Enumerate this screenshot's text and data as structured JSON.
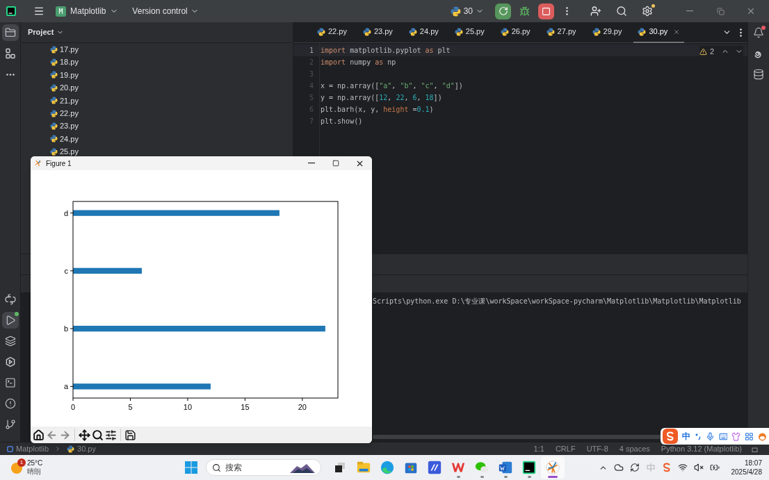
{
  "title_bar": {
    "project_badge": "M",
    "project": "Matplotlib",
    "vcs": "Version control",
    "run_config": "30"
  },
  "tool_stripe": {
    "left_top": [
      {
        "kind": "folder",
        "selected": true
      },
      {
        "kind": "structure",
        "selected": false
      },
      {
        "kind": "more",
        "selected": false
      }
    ],
    "left_bottom": [
      {
        "kind": "python",
        "selected": false
      },
      {
        "kind": "run",
        "selected": true
      },
      {
        "kind": "layers",
        "selected": false
      },
      {
        "kind": "services",
        "selected": false
      },
      {
        "kind": "terminal",
        "selected": false
      },
      {
        "kind": "problems",
        "selected": false
      },
      {
        "kind": "git",
        "selected": false
      }
    ],
    "right": [
      {
        "kind": "bell",
        "selected": false
      },
      {
        "kind": "spiral",
        "selected": false
      },
      {
        "kind": "database",
        "selected": false
      }
    ]
  },
  "project_panel": {
    "title": "Project",
    "files": [
      "17.py",
      "18.py",
      "19.py",
      "20.py",
      "21.py",
      "22.py",
      "23.py",
      "24.py",
      "25.py"
    ]
  },
  "editor": {
    "tabs": [
      {
        "label": "22.py",
        "selected": false
      },
      {
        "label": "23.py",
        "selected": false
      },
      {
        "label": "24.py",
        "selected": false
      },
      {
        "label": "25.py",
        "selected": false
      },
      {
        "label": "26.py",
        "selected": false
      },
      {
        "label": "27.py",
        "selected": false
      },
      {
        "label": "29.py",
        "selected": false
      },
      {
        "label": "30.py",
        "selected": true
      }
    ],
    "warnings": "2",
    "lines": [
      {
        "number": "1",
        "current": true,
        "tokens": [
          {
            "kind": "keyword",
            "text": "import"
          },
          {
            "kind": "plain",
            "text": " matplotlib.pyplot "
          },
          {
            "kind": "keyword",
            "text": "as"
          },
          {
            "kind": "plain",
            "text": " plt"
          }
        ]
      },
      {
        "number": "2",
        "current": false,
        "tokens": [
          {
            "kind": "keyword",
            "text": "import"
          },
          {
            "kind": "plain",
            "text": " numpy "
          },
          {
            "kind": "keyword",
            "text": "as"
          },
          {
            "kind": "plain",
            "text": " np"
          }
        ]
      },
      {
        "number": "3",
        "current": false
      },
      {
        "number": "4",
        "current": false,
        "tokens": [
          {
            "kind": "plain",
            "text": "x = np.array(["
          },
          {
            "kind": "string",
            "text": "\"a\""
          },
          {
            "kind": "plain",
            "text": ", "
          },
          {
            "kind": "string",
            "text": "\"b\""
          },
          {
            "kind": "plain",
            "text": ", "
          },
          {
            "kind": "string",
            "text": "\"c\""
          },
          {
            "kind": "plain",
            "text": ", "
          },
          {
            "kind": "string",
            "text": "\"d\""
          },
          {
            "kind": "plain",
            "text": "])"
          }
        ]
      },
      {
        "number": "5",
        "current": false,
        "tokens": [
          {
            "kind": "plain",
            "text": "y = np.array(["
          },
          {
            "kind": "number",
            "text": "12"
          },
          {
            "kind": "plain",
            "text": ", "
          },
          {
            "kind": "number",
            "text": "22"
          },
          {
            "kind": "plain",
            "text": ", "
          },
          {
            "kind": "number",
            "text": "6"
          },
          {
            "kind": "plain",
            "text": ", "
          },
          {
            "kind": "number",
            "text": "18"
          },
          {
            "kind": "plain",
            "text": "])"
          }
        ]
      },
      {
        "number": "6",
        "current": false,
        "tokens": [
          {
            "kind": "plain",
            "text": "plt.barh(x, y, "
          },
          {
            "kind": "param",
            "text": "height"
          },
          {
            "kind": "plain",
            "text": " ="
          },
          {
            "kind": "number",
            "text": "0.1"
          },
          {
            "kind": "plain",
            "text": ")"
          }
        ]
      },
      {
        "number": "7",
        "current": false,
        "tokens": [
          {
            "kind": "plain",
            "text": "plt.show()"
          }
        ]
      }
    ]
  },
  "run_panel": {
    "console": "Scripts\\python.exe D:\\专业课\\workSpace\\workSpace-pycharm\\Matplotlib\\Matplotlib\\Matplotlib"
  },
  "status_bar": {
    "breadcrumb": [
      "Matplotlib",
      "30.py"
    ],
    "items": [
      "1:1",
      "CRLF",
      "UTF-8",
      "4 spaces",
      "Python 3.12 (Matplotlib)"
    ]
  },
  "figure": {
    "title": "Figure 1",
    "chart_data": {
      "type": "bar",
      "orientation": "horizontal",
      "categories": [
        "d",
        "c",
        "b",
        "a"
      ],
      "series": [
        {
          "color": "#1f77b4",
          "values": [
            18,
            6,
            22,
            12
          ]
        }
      ],
      "xlim": [
        0,
        23.1
      ],
      "xticks": [
        0,
        5,
        10,
        15,
        20
      ]
    }
  },
  "ime_bar": {
    "mode": "中"
  },
  "taskbar": {
    "weather": {
      "temp": "25°C",
      "desc": "晴朗",
      "badge": "1"
    },
    "search_placeholder": "搜索",
    "apps": [
      {
        "kind": "explorer",
        "running": false,
        "selected": false
      },
      {
        "kind": "edge",
        "running": false,
        "selected": false
      },
      {
        "kind": "store",
        "running": false,
        "selected": false
      },
      {
        "kind": "blue-app",
        "running": false,
        "selected": false
      },
      {
        "kind": "wps",
        "running": true,
        "selected": false
      },
      {
        "kind": "wechat",
        "running": true,
        "selected": false
      },
      {
        "kind": "word",
        "running": true,
        "selected": false
      },
      {
        "kind": "pycharm",
        "running": true,
        "selected": false
      },
      {
        "kind": "figure",
        "running": true,
        "selected": true
      }
    ],
    "time": "18:07",
    "date": "2025/4/28"
  }
}
